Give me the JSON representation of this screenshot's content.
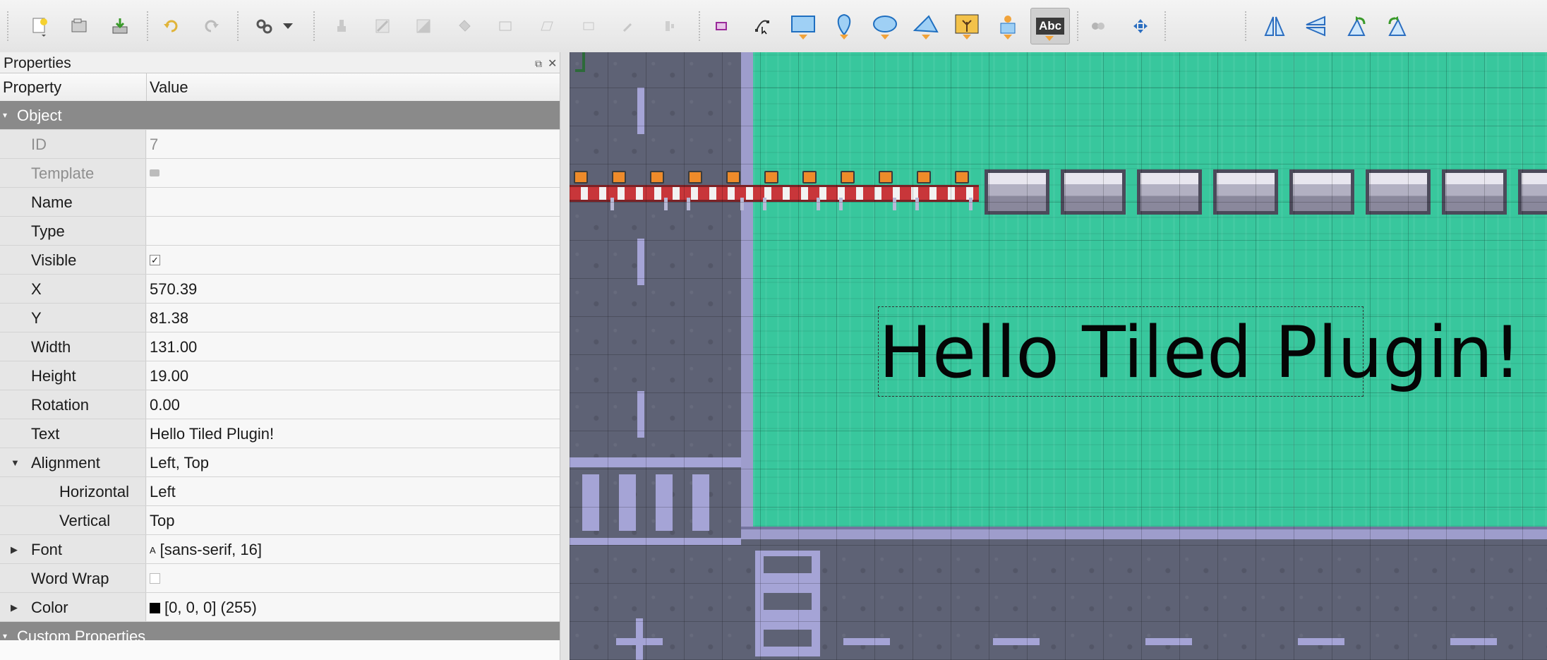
{
  "toolbar": {
    "icons": [
      "new-map-icon",
      "open-icon",
      "save-icon",
      "undo-icon",
      "redo-icon",
      "stamp-settings-icon",
      "stamp-brush-icon",
      "terrain-brush-icon",
      "eraser-icon",
      "bucket-fill-icon",
      "rectangle-select-icon",
      "shape-fill-icon",
      "magic-wand-icon",
      "select-same-tile-icon",
      "pick-tile-icon",
      "select-objects-icon",
      "edit-polygons-icon",
      "insert-rectangle-icon",
      "insert-point-icon",
      "insert-ellipse-icon",
      "insert-polygon-icon",
      "insert-tile-icon",
      "insert-template-icon",
      "insert-text-icon",
      "disabled-tool-icon",
      "move-icon",
      "flip-horizontal-icon",
      "flip-vertical-icon",
      "rotate-left-icon",
      "rotate-right-icon"
    ],
    "text_tool_label": "Abc"
  },
  "panel": {
    "title": "Properties",
    "header": {
      "property": "Property",
      "value": "Value"
    },
    "object_group": "Object",
    "rows": {
      "id": {
        "label": "ID",
        "value": "7"
      },
      "template": {
        "label": "Template"
      },
      "name": {
        "label": "Name",
        "value": ""
      },
      "type": {
        "label": "Type",
        "value": ""
      },
      "visible": {
        "label": "Visible",
        "checked": true
      },
      "x": {
        "label": "X",
        "value": "570.39"
      },
      "y": {
        "label": "Y",
        "value": "81.38"
      },
      "width": {
        "label": "Width",
        "value": "131.00"
      },
      "height": {
        "label": "Height",
        "value": "19.00"
      },
      "rotation": {
        "label": "Rotation",
        "value": "0.00"
      },
      "text": {
        "label": "Text",
        "value": "Hello Tiled Plugin!"
      },
      "alignment": {
        "label": "Alignment",
        "value": "Left, Top"
      },
      "horizontal": {
        "label": "Horizontal",
        "value": "Left"
      },
      "vertical": {
        "label": "Vertical",
        "value": "Top"
      },
      "font": {
        "label": "Font",
        "value": "[sans-serif, 16]",
        "icon": "A"
      },
      "word_wrap": {
        "label": "Word Wrap",
        "checked": false
      },
      "color": {
        "label": "Color",
        "value": "[0, 0, 0] (255)",
        "swatch": "#000000"
      }
    },
    "custom_group": "Custom Properties"
  },
  "canvas": {
    "text_object": "Hello Tiled Plugin!",
    "grass_color": "#38c79d",
    "road_color": "#5e6275"
  }
}
